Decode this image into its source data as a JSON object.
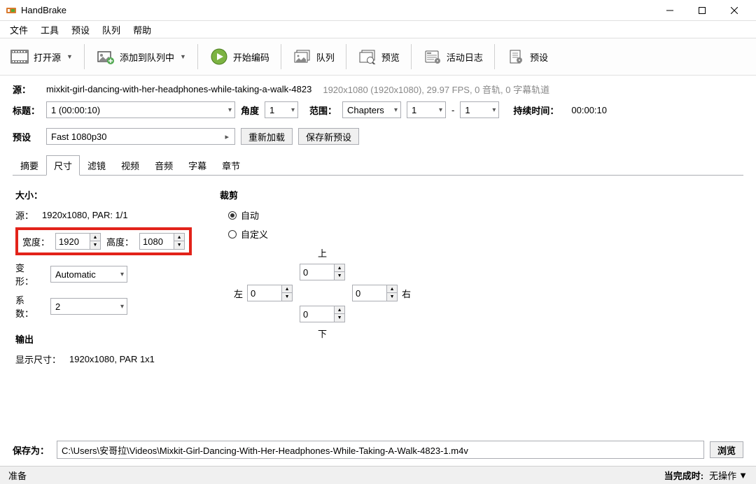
{
  "window": {
    "title": "HandBrake"
  },
  "menu": [
    "文件",
    "工具",
    "预设",
    "队列",
    "帮助"
  ],
  "toolbar": {
    "open": "打开源",
    "add": "添加到队列中",
    "start": "开始编码",
    "queue": "队列",
    "preview": "预览",
    "log": "活动日志",
    "preset": "预设"
  },
  "source": {
    "label": "源：",
    "name": "mixkit-girl-dancing-with-her-headphones-while-taking-a-walk-4823",
    "info": "1920x1080 (1920x1080), 29.97 FPS, 0 音轨, 0 字幕轨道"
  },
  "title": {
    "label": "标题：",
    "value": "1 (00:00:10)",
    "angle_label": "角度",
    "angle": "1",
    "range_label": "范围：",
    "range_type": "Chapters",
    "range_from": "1",
    "range_dash": "-",
    "range_to": "1",
    "duration_label": "持续时间：",
    "duration": "00:00:10"
  },
  "preset": {
    "label": "预设",
    "value": "Fast 1080p30",
    "reload": "重新加载",
    "save": "保存新预设"
  },
  "tabs": [
    "摘要",
    "尺寸",
    "滤镜",
    "视频",
    "音频",
    "字幕",
    "章节"
  ],
  "size": {
    "section": "大小：",
    "src_label": "源：",
    "src_value": "1920x1080, PAR: 1/1",
    "width_label": "宽度：",
    "width": "1920",
    "height_label": "高度：",
    "height": "1080",
    "anamorphic_label": "变形：",
    "anamorphic": "Automatic",
    "modulus_label": "系数：",
    "modulus": "2",
    "output_section": "输出",
    "display_label": "显示尺寸：",
    "display_value": "1920x1080,  PAR 1x1"
  },
  "crop": {
    "section": "裁剪",
    "auto": "自动",
    "custom": "自定义",
    "top_label": "上",
    "top": "0",
    "left_label": "左",
    "left": "0",
    "right_label": "右",
    "right": "0",
    "bottom_label": "下",
    "bottom": "0"
  },
  "save": {
    "label": "保存为：",
    "path": "C:\\Users\\安哥拉\\Videos\\Mixkit-Girl-Dancing-With-Her-Headphones-While-Taking-A-Walk-4823-1.m4v",
    "browse": "浏览"
  },
  "status": {
    "ready": "准备",
    "done_label": "当完成时:",
    "done_action": "无操作"
  }
}
